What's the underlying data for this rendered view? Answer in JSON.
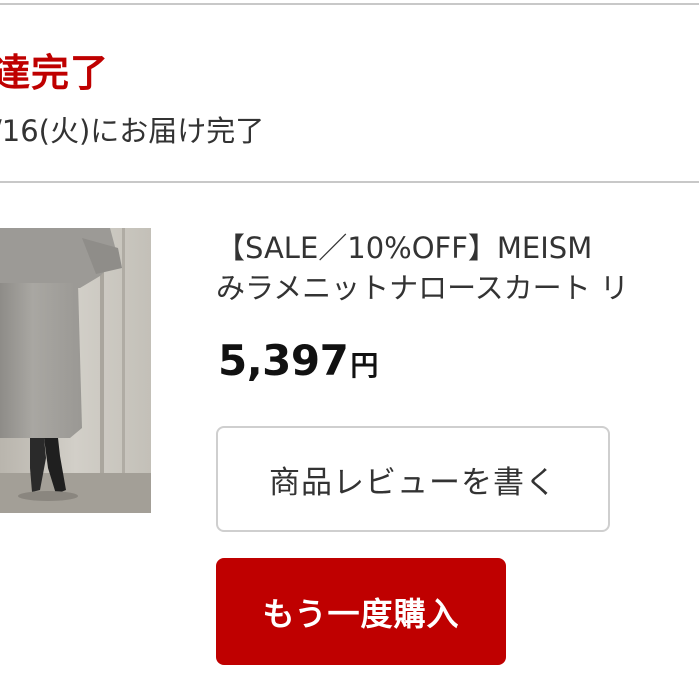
{
  "order": {
    "status_title": "達完了",
    "delivery_note": "/16(火)にお届け完了"
  },
  "product": {
    "name_line1": "【SALE／10%OFF】MEISM",
    "name_line2": "みラメニットナロースカート リ",
    "price": "5,397",
    "currency": "円",
    "image_icon": "product-photo-skirt"
  },
  "actions": {
    "review_label": "商品レビューを書く",
    "rebuy_label": "もう一度購入"
  },
  "colors": {
    "accent": "#bf0000",
    "divider": "#c8c8c8"
  }
}
